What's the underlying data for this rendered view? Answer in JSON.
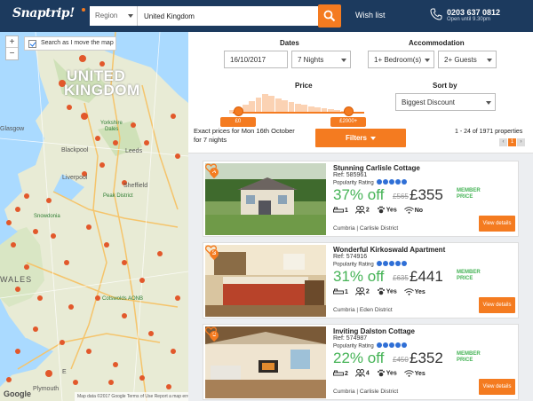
{
  "header": {
    "logo": "Snaptrip!",
    "region_label": "Region",
    "search_value": "United Kingdom",
    "wishlist": "Wish list",
    "phone": "0203 637 0812",
    "hours": "Open until 9.30pm"
  },
  "map": {
    "zoom_in": "+",
    "zoom_out": "−",
    "search_as_move": "Search as I move the map",
    "labels": {
      "united": "UNITED",
      "kingdom": "KINGDOM",
      "glasgow": "Glasgow",
      "yorkshire": "Yorkshire",
      "dales": "Dales",
      "leeds": "Leeds",
      "blackpool": "Blackpool",
      "liverpool": "Liverpool",
      "sheffield": "Sheffield",
      "peak": "Peak District",
      "snowdonia": "Snowdonia",
      "wales": "WALES",
      "cotswolds": "Cotswolds AONB",
      "plymouth": "Plymouth",
      "ex": "E"
    },
    "google": "Google",
    "footer": "Map data ©2017 Google   Terms of Use   Report a map error"
  },
  "filters": {
    "dates_label": "Dates",
    "date_value": "16/10/2017",
    "nights_value": "7 Nights",
    "accommodation_label": "Accommodation",
    "bedrooms_value": "1+ Bedroom(s)",
    "guests_value": "2+ Guests",
    "price_label": "Price",
    "price_min": "£0",
    "price_max": "£2000+",
    "price_range_fraction": [
      0.04,
      0.88
    ],
    "sort_label": "Sort by",
    "sort_value": "Biggest Discount",
    "exact_text": "Exact prices for Mon 16th October for 7 nights",
    "filters_button": "Filters",
    "count_text": "1 - 24 of 1971 properties",
    "page_prev": "‹",
    "page_current": "1",
    "page_next": "›"
  },
  "listings": [
    {
      "badge": "A",
      "title": "Stunning Carlisle Cottage",
      "ref": "Ref: 585961",
      "popularity_label": "Popularity Rating",
      "popularity": 5,
      "discount": "37% off",
      "was": "£565",
      "price": "£355",
      "member": "MEMBER PRICE",
      "bedrooms": "1",
      "guests": "2",
      "pets": "Yes",
      "wifi": "No",
      "location": "Cumbria  |  Carlisle District",
      "button": "View details"
    },
    {
      "badge": "B",
      "title": "Wonderful Kirkoswald Apartment",
      "ref": "Ref: 574916",
      "popularity_label": "Popularity Rating",
      "popularity": 5,
      "discount": "31% off",
      "was": "£635",
      "price": "£441",
      "member": "MEMBER PRICE",
      "bedrooms": "1",
      "guests": "2",
      "pets": "Yes",
      "wifi": "Yes",
      "location": "Cumbria  |  Eden District",
      "button": "View details"
    },
    {
      "badge": "C",
      "title": "Inviting Dalston Cottage",
      "ref": "Ref: 574987",
      "popularity_label": "Popularity Rating",
      "popularity": 5,
      "discount": "22% off",
      "was": "£450",
      "price": "£352",
      "member": "MEMBER PRICE",
      "bedrooms": "2",
      "guests": "4",
      "pets": "Yes",
      "wifi": "Yes",
      "location": "Cumbria  |  Carlisle District",
      "button": "View details"
    }
  ],
  "colors": {
    "header_bg": "#1c3a5e",
    "accent": "#f47b20",
    "discount_green": "#45b356",
    "rating_blue": "#2f6fd6"
  }
}
